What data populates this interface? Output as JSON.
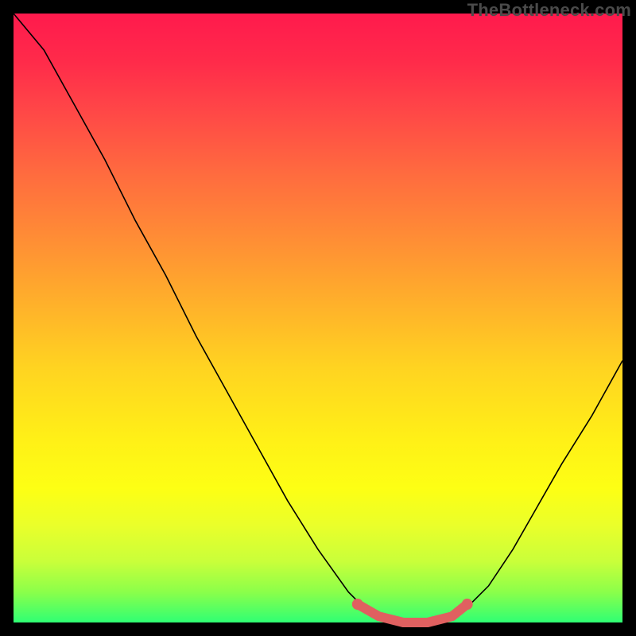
{
  "watermark": "TheBottleneck.com",
  "chart_data": {
    "type": "line",
    "title": "",
    "xlabel": "",
    "ylabel": "",
    "xlim": [
      0,
      1
    ],
    "ylim": [
      0,
      1
    ],
    "background_gradient": {
      "top": "#ff1a4d",
      "mid": "#fff017",
      "bottom": "#2fff74"
    },
    "series": [
      {
        "name": "bottleneck-curve",
        "x": [
          0.0,
          0.05,
          0.1,
          0.15,
          0.2,
          0.25,
          0.3,
          0.35,
          0.4,
          0.45,
          0.5,
          0.55,
          0.58,
          0.62,
          0.66,
          0.7,
          0.74,
          0.78,
          0.82,
          0.86,
          0.9,
          0.95,
          1.0
        ],
        "y": [
          1.0,
          0.94,
          0.85,
          0.76,
          0.66,
          0.57,
          0.47,
          0.38,
          0.29,
          0.2,
          0.12,
          0.05,
          0.02,
          0.0,
          0.0,
          0.0,
          0.02,
          0.06,
          0.12,
          0.19,
          0.26,
          0.34,
          0.43
        ]
      }
    ],
    "accent_segment": {
      "name": "highlight-strip",
      "color": "#e06060",
      "x": [
        0.565,
        0.6,
        0.64,
        0.68,
        0.72,
        0.745
      ],
      "y": [
        0.03,
        0.01,
        0.0,
        0.0,
        0.01,
        0.03
      ]
    },
    "accent_end_dots": [
      {
        "x": 0.565,
        "y": 0.03
      },
      {
        "x": 0.745,
        "y": 0.03
      }
    ]
  }
}
